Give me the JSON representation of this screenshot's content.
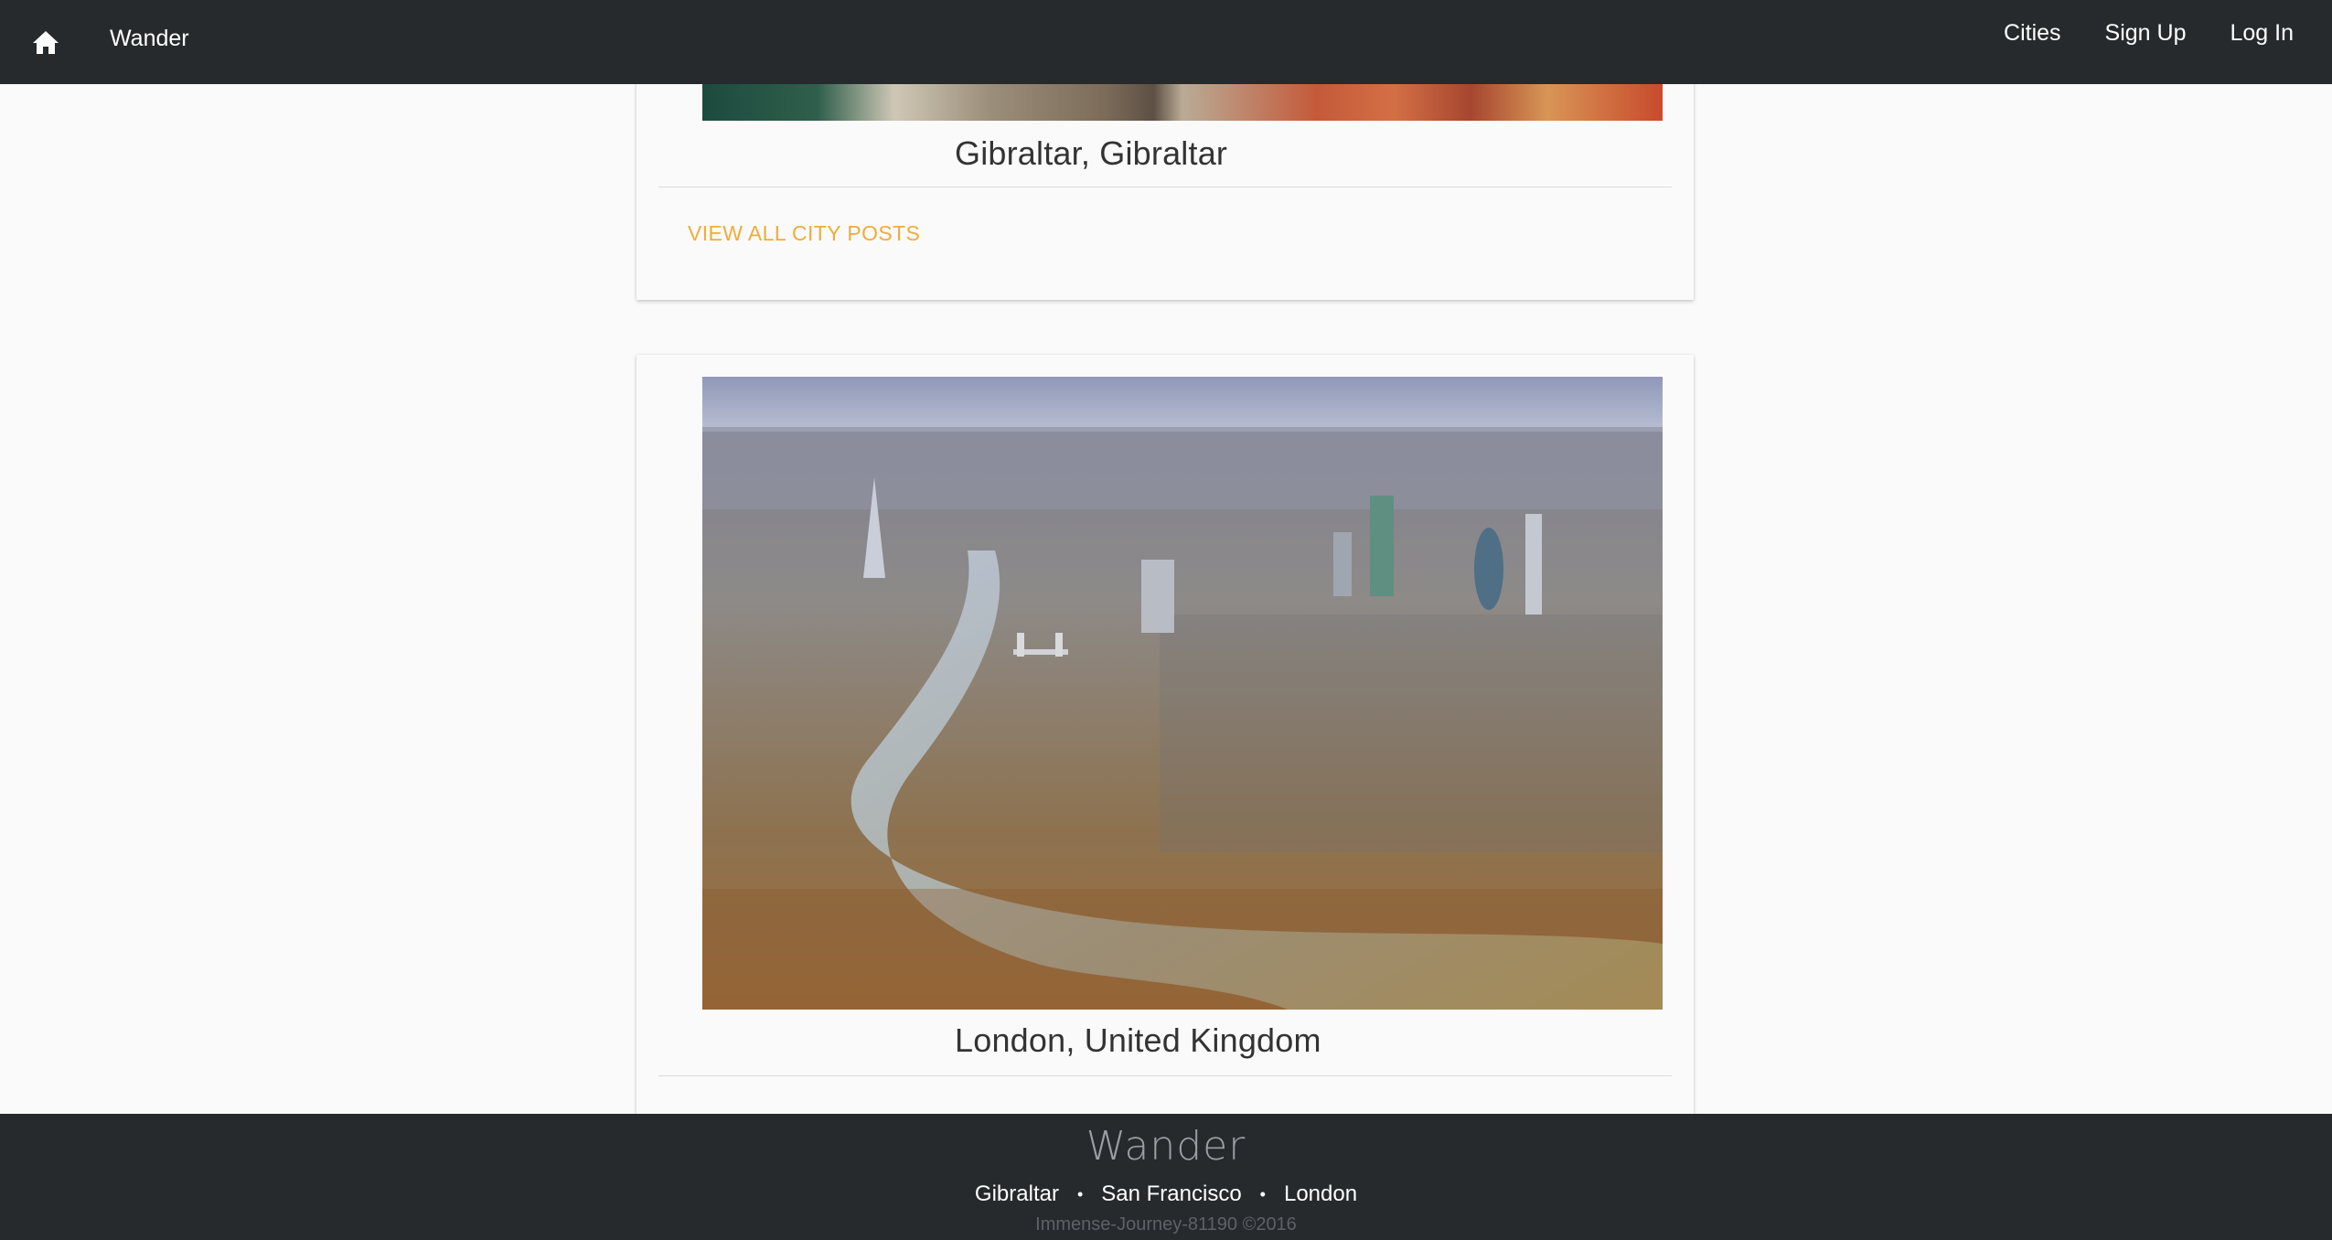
{
  "header": {
    "brand": "Wander",
    "home_icon": "home-icon",
    "nav": [
      "Cities",
      "Sign Up",
      "Log In"
    ]
  },
  "cards": [
    {
      "city": "Gibraltar, Gibraltar",
      "link": "VIEW ALL CITY POSTS"
    },
    {
      "city": "London, United Kingdom"
    }
  ],
  "footer": {
    "brand": "Wander",
    "cities": [
      "Gibraltar",
      "San Francisco",
      "London"
    ],
    "separator": "•",
    "copyright": "Immense-Journey-81190 ©2016"
  },
  "colors": {
    "bar": "#262a2d",
    "page": "#fafafa",
    "accent": "#f2ab3a"
  }
}
